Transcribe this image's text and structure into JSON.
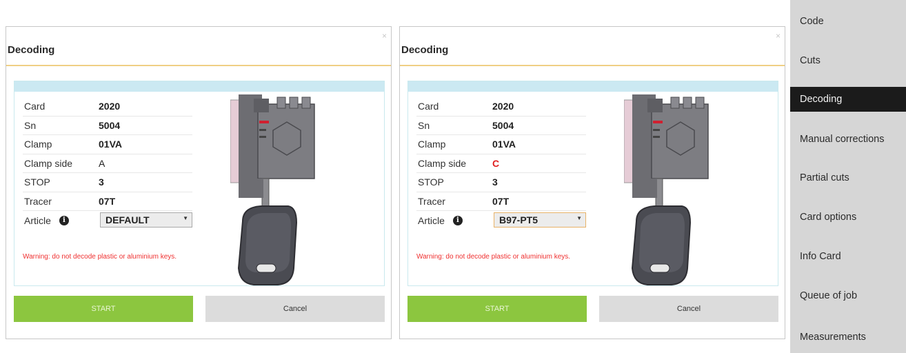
{
  "dialogs": [
    {
      "title": "Decoding",
      "close": "×",
      "rows": [
        {
          "label": "Card",
          "value": "2020"
        },
        {
          "label": "Sn",
          "value": "5004"
        },
        {
          "label": "Clamp",
          "value": "01VA"
        },
        {
          "label": "Clamp side",
          "value": "A"
        },
        {
          "label": "STOP",
          "value": "3"
        },
        {
          "label": "Tracer",
          "value": "07T"
        }
      ],
      "article_label": "Article",
      "article_value": "DEFAULT",
      "warning": "Warning: do not decode plastic or aluminium keys.",
      "start": "START",
      "cancel": "Cancel"
    },
    {
      "title": "Decoding",
      "close": "×",
      "rows": [
        {
          "label": "Card",
          "value": "2020"
        },
        {
          "label": "Sn",
          "value": "5004"
        },
        {
          "label": "Clamp",
          "value": "01VA"
        },
        {
          "label": "Clamp side",
          "value": "C"
        },
        {
          "label": "STOP",
          "value": "3"
        },
        {
          "label": "Tracer",
          "value": "07T"
        }
      ],
      "article_label": "Article",
      "article_value": "B97-PT5",
      "warning": "Warning: do not decode plastic or aluminium keys.",
      "start": "START",
      "cancel": "Cancel"
    }
  ],
  "sidebar": {
    "items": [
      {
        "label": "Code"
      },
      {
        "label": "Cuts"
      },
      {
        "label": "Decoding",
        "active": true
      },
      {
        "label": "Manual corrections"
      },
      {
        "label": "Partial cuts"
      },
      {
        "label": "Card options"
      },
      {
        "label": "Info Card"
      },
      {
        "label": "Queue of job"
      },
      {
        "label": "Measurements"
      }
    ]
  },
  "colors": {
    "accent_rule": "#f0cf84",
    "panel_header": "#cbe9f2",
    "start_button": "#8cc63f",
    "cancel_button": "#dcdcdc",
    "warning": "#ef3030",
    "highlight_value": "#e02020",
    "sidebar_active": "#1b1b1b"
  },
  "icons": {
    "info": "info-circle-icon",
    "close": "close-icon",
    "dropdown": "dropdown-arrow-icon",
    "key": "key-in-clamp-illustration"
  }
}
